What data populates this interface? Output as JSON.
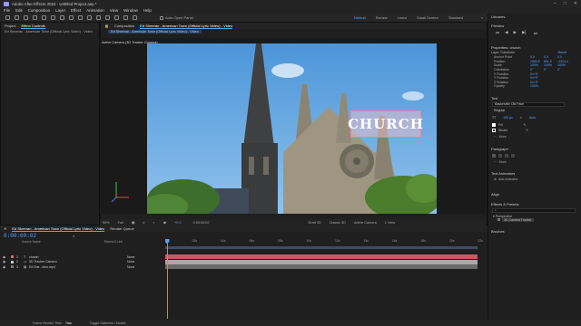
{
  "titlebar": {
    "title": "Adobe After Effects 2024 - Untitled Project.aep *"
  },
  "menu": [
    "File",
    "Edit",
    "Composition",
    "Layer",
    "Effect",
    "Animation",
    "View",
    "Window",
    "Help"
  ],
  "toolbar": {
    "auto_open": "Auto-Open Panel",
    "workspaces": [
      "Default",
      "Review",
      "Learn",
      "Small Screen",
      "Standard"
    ],
    "active_workspace": "Default",
    "library_label": "Libraries"
  },
  "left_panels": {
    "project_tab": "Project",
    "effect_controls_tab": "Effect Controls",
    "effect_controls_sub": "Ed Sheeran - American Town (Official Lyric Video) - Video"
  },
  "composition": {
    "tab": "Composition",
    "tab_name": "Ed Sheeran - American Town (Official Lyric Video) - Video",
    "breadcrumb": "Ed Sheeran - American Town (Official Lyric Video) - Video",
    "active_camera": "Active Camera (3D Tracker Camera)",
    "overlay_text": "CHURCH"
  },
  "viewer_bar": {
    "zoom": "50%",
    "resolution": "Full",
    "plus_value": "+0.0",
    "timecode": "0:00:00:02",
    "renderer": "Draft 3D",
    "renderer_mode": "Classic 3D",
    "camera": "Active Camera",
    "views": "1 View"
  },
  "timeline": {
    "tab": "Ed Sheeran - American Town (Official Lyric Video) - Video",
    "render_queue": "Render Queue",
    "timecode": "0:00:00:02",
    "col_source": "Source Name",
    "col_parent": "Parent & Link",
    "layers": [
      {
        "num": "1",
        "name": "church",
        "parent": "None",
        "color": "#d96b6b"
      },
      {
        "num": "2",
        "name": "3D Tracker Camera",
        "parent": "None",
        "color": "#c8c8c8"
      },
      {
        "num": "3",
        "name": "Ed She...ideo.mp4",
        "parent": "None",
        "color": "#7a7a7a"
      }
    ],
    "ruler": [
      "0s",
      "02s",
      "04s",
      "06s",
      "08s",
      "10s",
      "12s",
      "14s",
      "16s",
      "18s",
      "20s",
      "22s"
    ]
  },
  "right_panel": {
    "preview": "Preview",
    "properties_title": "Properties: church",
    "layer_transform": "Layer Transform",
    "reset": "Reset",
    "props": [
      {
        "name": "Anchor Point",
        "v1": "0.0",
        "v2": "0.0",
        "v3": "0.0"
      },
      {
        "name": "Position",
        "v1": "1083.5",
        "v2": "891.9",
        "v3": "-1424.4"
      },
      {
        "name": "Scale",
        "v1": "100%",
        "v2": "100%",
        "v3": "100%"
      },
      {
        "name": "Orientation",
        "v1": "0°",
        "v2": "0°",
        "v3": "0°"
      },
      {
        "name": "X Rotation",
        "v1": "0x+0°",
        "v2": "",
        "v3": ""
      },
      {
        "name": "Y Rotation",
        "v1": "0x+0°",
        "v2": "",
        "v3": ""
      },
      {
        "name": "Z Rotation",
        "v1": "0x+0°",
        "v2": "",
        "v3": ""
      },
      {
        "name": "Opacity",
        "v1": "100%",
        "v2": "",
        "v3": ""
      }
    ],
    "text_section": "Text",
    "font": "Baskerville Old Face",
    "style": "Regular",
    "font_size": "100 px",
    "leading": "Auto",
    "fill_label": "Fill",
    "stroke_label": "Stroke",
    "more": "More",
    "paragraph": "Paragraph",
    "more2": "More",
    "text_animators": "Text Animators",
    "add_animator": "Add Animator",
    "align": "Align",
    "effects_presets": "Effects & Presets",
    "perspective": "Perspective",
    "preset_item": "3D Camera Tracker",
    "brushes": "Brushes"
  },
  "status_bar": {
    "frame_render": "Frame Render Time",
    "frame_render_val": "7ms",
    "toggle": "Toggle Switches / Modes"
  }
}
